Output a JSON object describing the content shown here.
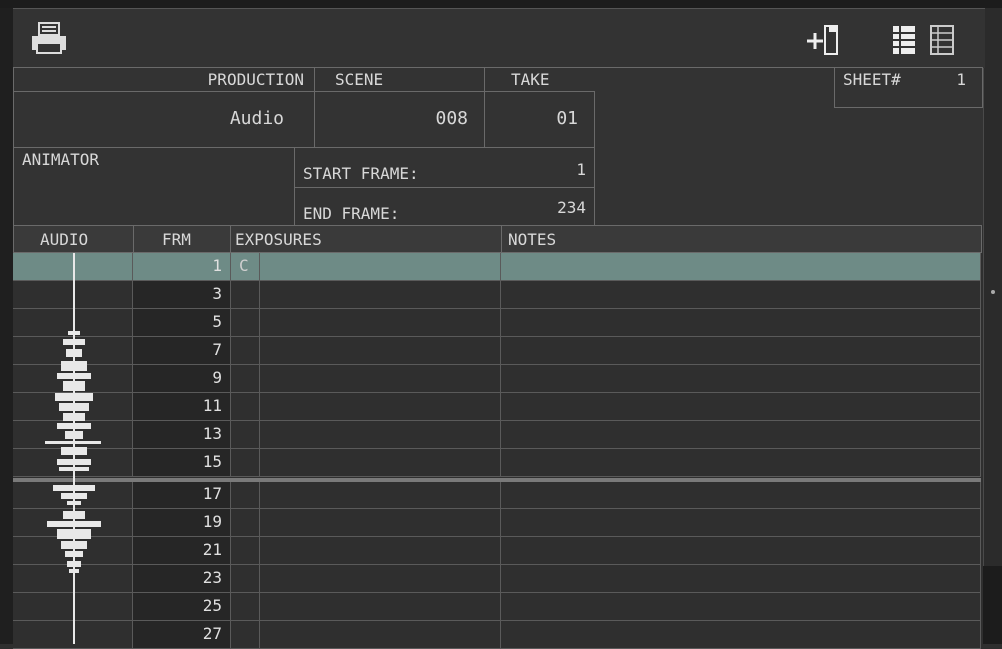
{
  "toolbar": {
    "print_icon": "printer-icon",
    "add_icon": "add-column-icon",
    "view_icons": [
      "list-filled-icon",
      "list-outline-icon"
    ]
  },
  "sheet": {
    "label": "SHEET#",
    "value": "1"
  },
  "header": {
    "production_label": "PRODUCTION",
    "production_value": "Audio",
    "scene_label": "SCENE",
    "scene_value": "008",
    "take_label": "TAKE",
    "take_value": "01",
    "animator_label": "ANIMATOR",
    "start_frame_label": "START FRAME:",
    "start_frame_value": "1",
    "end_frame_label": "END FRAME:",
    "end_frame_value": "234"
  },
  "columns": {
    "audio": "AUDIO",
    "frm": "FRM",
    "exposures": "EXPOSURES",
    "notes": "NOTES"
  },
  "rows": [
    {
      "frm": "1",
      "exposure": "C",
      "highlighted": true
    },
    {
      "frm": "3",
      "exposure": ""
    },
    {
      "frm": "5",
      "exposure": ""
    },
    {
      "frm": "7",
      "exposure": ""
    },
    {
      "frm": "9",
      "exposure": ""
    },
    {
      "frm": "11",
      "exposure": ""
    },
    {
      "frm": "13",
      "exposure": ""
    },
    {
      "frm": "15",
      "exposure": ""
    },
    {
      "frm": "17",
      "exposure": ""
    },
    {
      "frm": "19",
      "exposure": ""
    },
    {
      "frm": "21",
      "exposure": ""
    },
    {
      "frm": "23",
      "exposure": ""
    },
    {
      "frm": "25",
      "exposure": ""
    },
    {
      "frm": "27",
      "exposure": ""
    }
  ],
  "colors": {
    "highlight": "#6e8b86",
    "background": "#333333",
    "frm_bg": "#262626"
  }
}
